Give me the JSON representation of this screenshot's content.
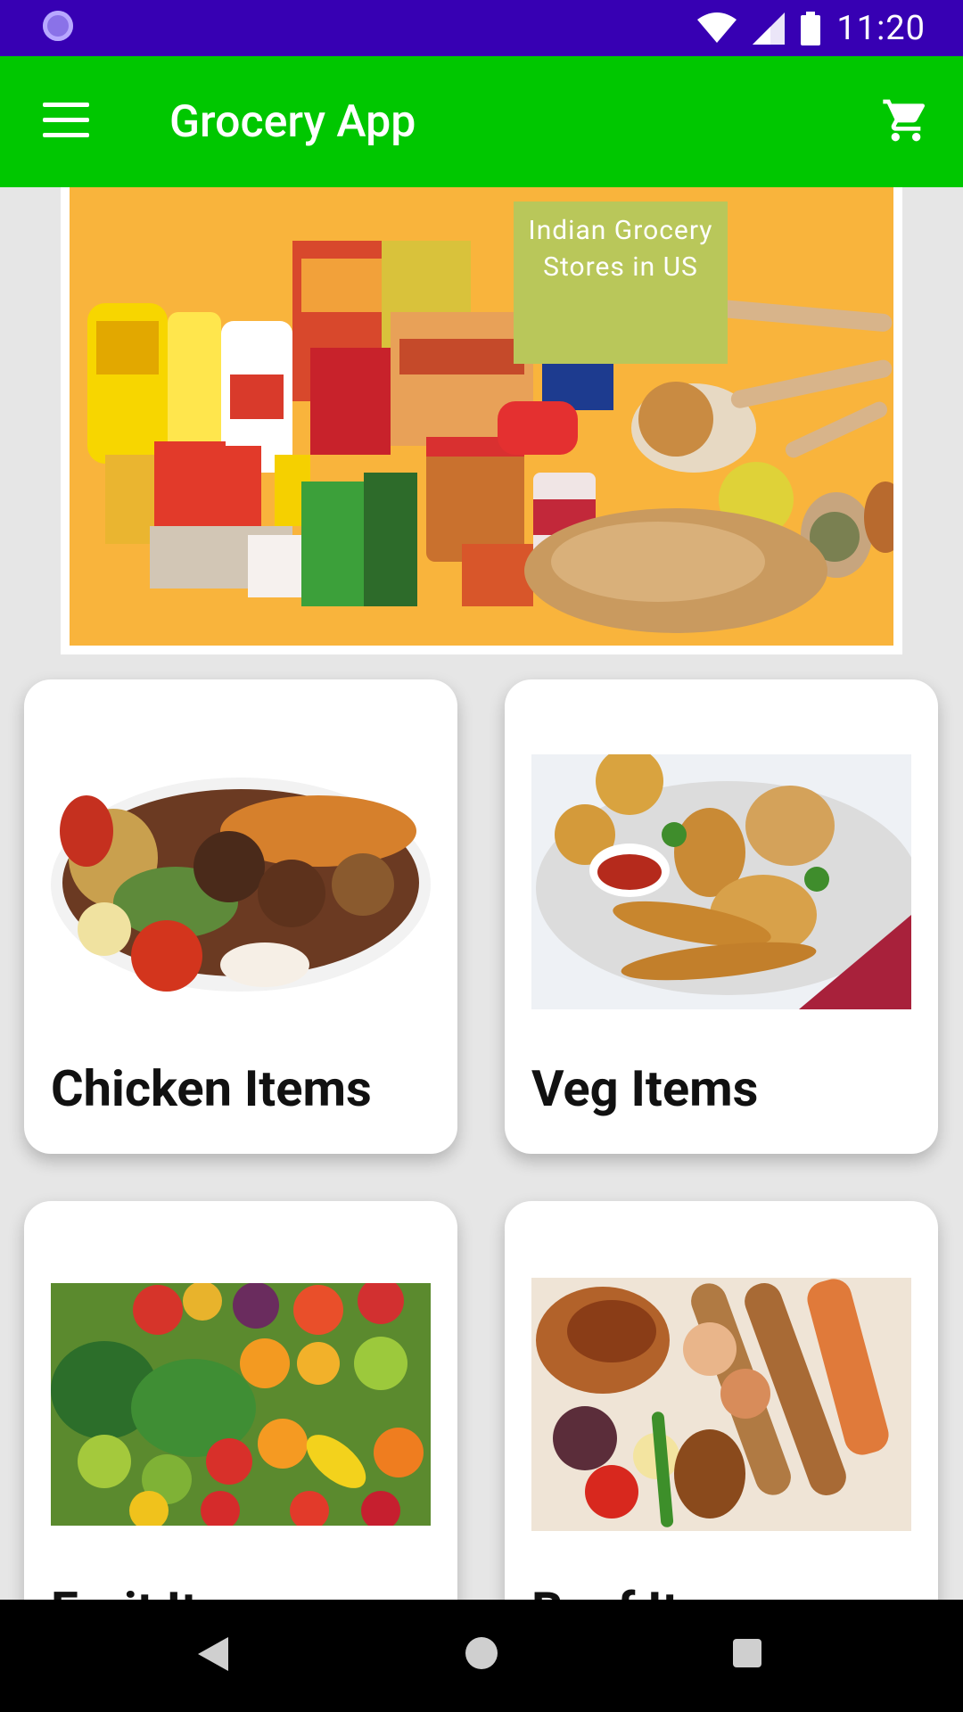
{
  "status_bar": {
    "time": "11:20"
  },
  "app_bar": {
    "title": "Grocery App"
  },
  "banner": {
    "tag_line1": "Indian Grocery",
    "tag_line2": "Stores in US"
  },
  "categories": [
    {
      "label": "Chicken Items"
    },
    {
      "label": "Veg Items"
    },
    {
      "label": "Fruit Items"
    },
    {
      "label": "Beef Items"
    }
  ],
  "colors": {
    "status_bar": "#3700b3",
    "app_bar": "#00c700",
    "banner_bg": "#f9b43c"
  }
}
